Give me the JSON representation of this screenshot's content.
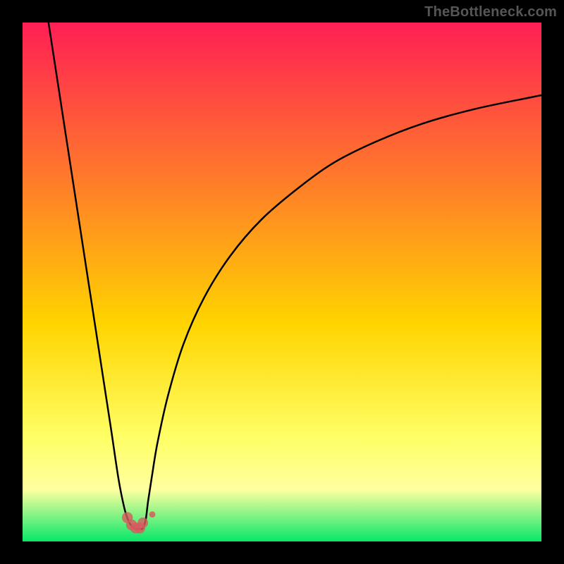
{
  "attribution": {
    "label": "TheBottleneck.com"
  },
  "chart_data": {
    "type": "line",
    "title": "",
    "xlabel": "",
    "ylabel": "",
    "xlim": [
      0,
      100
    ],
    "ylim": [
      0,
      100
    ],
    "gradient": {
      "top": "#ff1f55",
      "upper_mid": "#ff7a2a",
      "mid": "#ffd400",
      "lower_mid": "#ffff66",
      "band": "#ffffa0",
      "bottom": "#06e768"
    },
    "series": [
      {
        "name": "left-branch",
        "x": [
          5,
          7,
          9,
          11,
          13,
          15,
          17,
          18.5,
          19.6,
          20.4,
          21.2,
          22,
          22.5
        ],
        "y": [
          100,
          87,
          74,
          61,
          48,
          35,
          22,
          12,
          6.5,
          4.0,
          2.8,
          2.4,
          2.4
        ]
      },
      {
        "name": "right-branch",
        "x": [
          22.5,
          23,
          23.4,
          23.8,
          24.2,
          25,
          26,
          28,
          31,
          35,
          40,
          46,
          53,
          60,
          68,
          77,
          87,
          98,
          100
        ],
        "y": [
          2.4,
          2.4,
          3.0,
          4.6,
          7.8,
          13,
          19,
          28,
          38,
          47,
          55,
          62,
          68,
          73,
          77,
          80.5,
          83.3,
          85.6,
          86
        ]
      }
    ],
    "markers": [
      {
        "name": "valley-left-shoulder",
        "x": 20.2,
        "y": 4.6,
        "r": 1.05,
        "fill": "#d85a5e",
        "alpha": 0.8
      },
      {
        "name": "valley-left-inner",
        "x": 21.0,
        "y": 3.2,
        "r": 1.05,
        "fill": "#d85a5e",
        "alpha": 0.8
      },
      {
        "name": "valley-bottom-left",
        "x": 21.8,
        "y": 2.6,
        "r": 1.05,
        "fill": "#d85a5e",
        "alpha": 0.8
      },
      {
        "name": "valley-bottom-right",
        "x": 22.6,
        "y": 2.6,
        "r": 1.05,
        "fill": "#d85a5e",
        "alpha": 0.8
      },
      {
        "name": "valley-right-inner",
        "x": 23.2,
        "y": 3.6,
        "r": 1.0,
        "fill": "#d85a5e",
        "alpha": 0.8
      },
      {
        "name": "small-right-dot",
        "x": 25.0,
        "y": 5.2,
        "r": 0.6,
        "fill": "#d85a5e",
        "alpha": 0.85
      }
    ]
  }
}
